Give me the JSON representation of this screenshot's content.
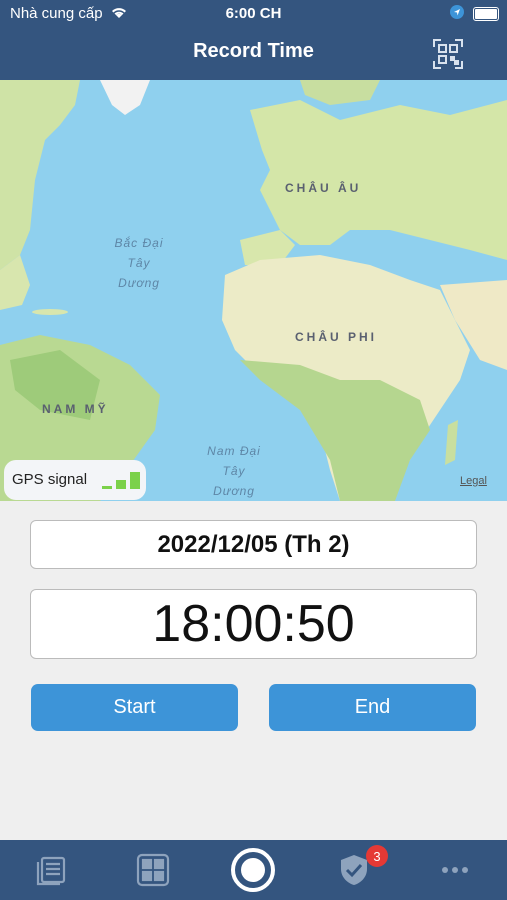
{
  "status_bar": {
    "carrier": "Nhà cung cấp",
    "time": "6:00 CH"
  },
  "header": {
    "title": "Record Time"
  },
  "map": {
    "labels": {
      "europe": "CHÂU ÂU",
      "africa": "CHÂU PHI",
      "south_america": "NAM MỸ"
    },
    "oceans": {
      "north_atlantic": [
        "Bắc Đại",
        "Tây",
        "Dương"
      ],
      "south_atlantic": [
        "Nam Đại",
        "Tây",
        "Dương"
      ]
    },
    "legal": "Legal",
    "gps_label": "GPS signal"
  },
  "record": {
    "date": "2022/12/05 (Th 2)",
    "time": "18:00:50",
    "start_label": "Start",
    "end_label": "End"
  },
  "tabbar": {
    "tabs": [
      "list-icon",
      "grid-icon",
      "record-icon",
      "shield-check-icon",
      "more-icon"
    ],
    "badge_count": "3"
  },
  "colors": {
    "header": "#34557f",
    "button": "#3d94d8",
    "badge": "#e53935",
    "gps_bar": "#7bd14a"
  }
}
